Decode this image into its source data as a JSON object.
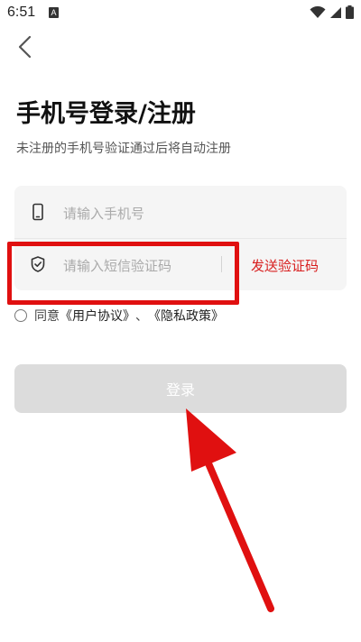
{
  "status_bar": {
    "time": "6:51",
    "notification_letter": "A",
    "icons": [
      "wifi-icon",
      "signal-icon",
      "battery-icon"
    ]
  },
  "header": {
    "back_icon": "chevron-left-icon",
    "title": "手机号登录/注册",
    "subtitle": "未注册的手机号验证通过后将自动注册"
  },
  "form": {
    "phone_placeholder": "请输入手机号",
    "code_placeholder": "请输入短信验证码",
    "send_code_label": "发送验证码"
  },
  "agreement": {
    "prefix": "同意",
    "user_agreement": "《用户协议》",
    "separator": "、",
    "privacy_policy": "《隐私政策》"
  },
  "login_button": {
    "label": "登录"
  },
  "colors": {
    "accent_red": "#d81e1e",
    "annotation_red": "#e01010",
    "button_disabled": "#dcdcdc",
    "card_bg": "#f5f5f5"
  }
}
